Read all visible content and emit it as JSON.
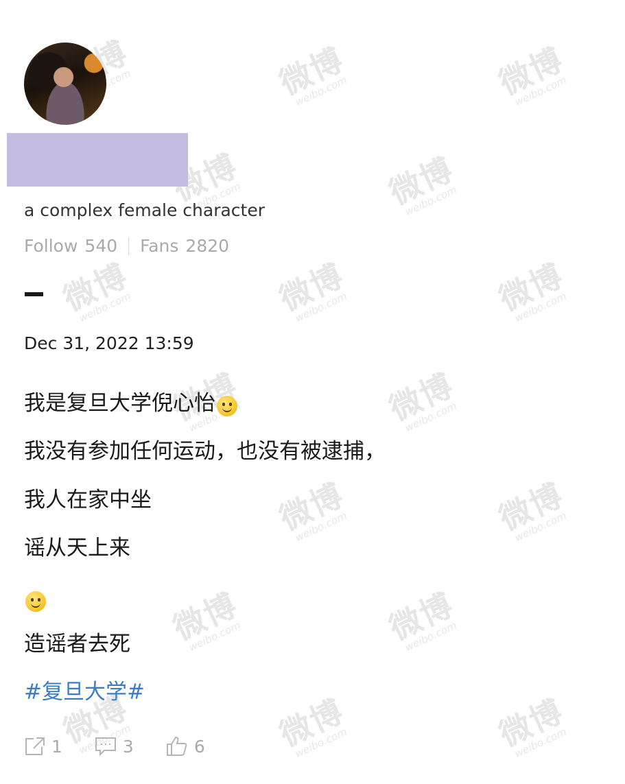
{
  "watermark": {
    "cn": "微博",
    "en": "weibo.com"
  },
  "profile": {
    "bio": "a complex female character",
    "follow_label": "Follow",
    "follow_count": "540",
    "fans_label": "Fans",
    "fans_count": "2820"
  },
  "post": {
    "date": "Dec 31, 2022 13:59",
    "lines": [
      "我是复旦大学倪心怡",
      "我没有参加任何运动，也没有被逮捕，",
      "我人在家中坐",
      "谣从天上来",
      "造谣者去死"
    ],
    "hashtag": "#复旦大学#"
  },
  "actions": {
    "repost_count": "1",
    "comment_count": "3",
    "like_count": "6"
  },
  "colors": {
    "redaction": "#c4bbe3",
    "hashtag": "#3c7cc4",
    "muted": "#aaaaaa"
  },
  "icons": [
    "repost-icon",
    "comment-icon",
    "like-icon",
    "smile-emoji-icon"
  ]
}
